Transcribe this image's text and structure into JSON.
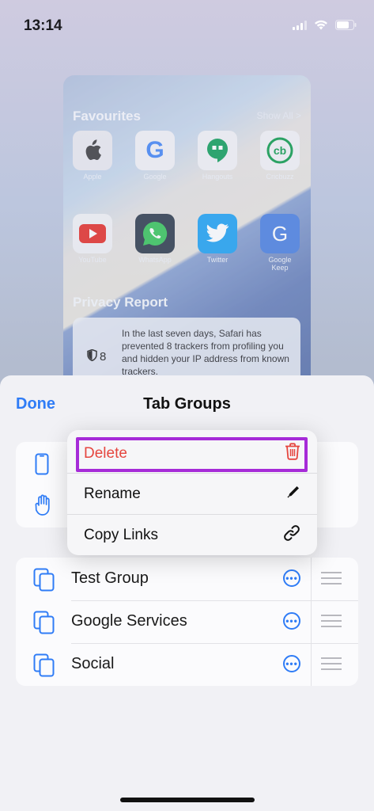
{
  "status": {
    "time": "13:14"
  },
  "preview": {
    "favourites_title": "Favourites",
    "show_all": "Show All >",
    "favourites": [
      {
        "label": "Apple",
        "icon": "apple-icon",
        "glyph": "",
        "bg": "#e9e9ee",
        "fg": "#333"
      },
      {
        "label": "Google",
        "icon": "google-icon",
        "glyph": "G",
        "bg": "#f1f1f4",
        "fg": "#4285f4"
      },
      {
        "label": "Hangouts",
        "icon": "hangouts-icon",
        "glyph": "❝",
        "bg": "#f1f1f4",
        "fg": "#0f9d58"
      },
      {
        "label": "Cricbuzz",
        "icon": "cricbuzz-icon",
        "glyph": "cb",
        "bg": "#f1f1f4",
        "fg": "#0b9a4a"
      },
      {
        "label": "YouTube",
        "icon": "youtube-icon",
        "glyph": "▶",
        "bg": "#f1f1f4",
        "fg": "#e52d27"
      },
      {
        "label": "WhatsApp",
        "icon": "whatsapp-icon",
        "glyph": "✆",
        "bg": "#2d3a4a",
        "fg": "#37c459"
      },
      {
        "label": "Twitter",
        "icon": "twitter-icon",
        "glyph": "🐦",
        "bg": "#1da1f2",
        "fg": "#ffffff"
      },
      {
        "label": "Google Keep",
        "icon": "google-keep-icon",
        "glyph": "G",
        "bg": "#4a7fe0",
        "fg": "#ffffff"
      }
    ],
    "privacy_title": "Privacy Report",
    "privacy_count": "8",
    "privacy_text": "In the last seven days, Safari has prevented 8 trackers from profiling you and hidden your IP address from known trackers."
  },
  "sheet": {
    "done_label": "Done",
    "title": "Tab Groups"
  },
  "context_menu": {
    "delete_label": "Delete",
    "rename_label": "Rename",
    "copy_links_label": "Copy Links"
  },
  "groups": [
    {
      "label": "Test Group"
    },
    {
      "label": "Google Services"
    },
    {
      "label": "Social"
    }
  ],
  "colors": {
    "accent": "#2f7cf6",
    "destructive": "#e5463f",
    "highlight": "#a62bd8"
  }
}
